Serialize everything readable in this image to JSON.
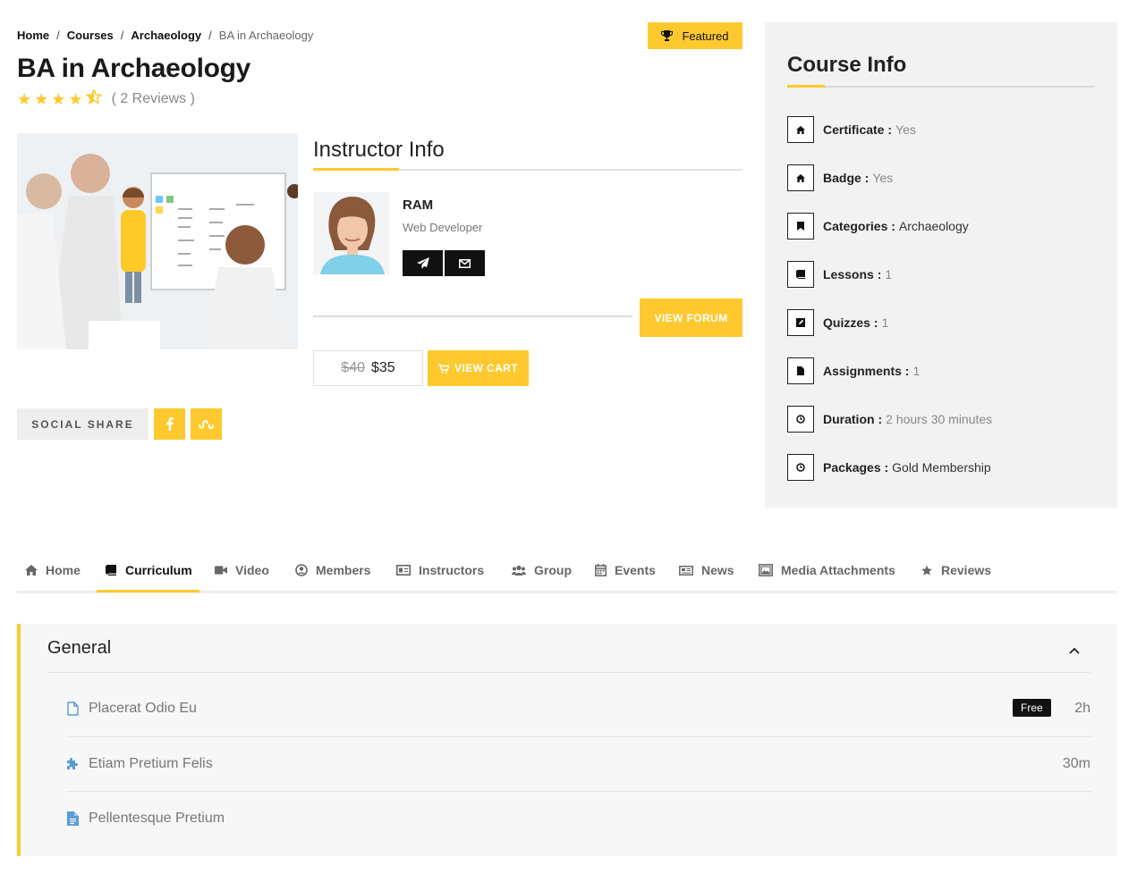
{
  "breadcrumb": {
    "items": [
      "Home",
      "Courses",
      "Archaeology"
    ],
    "current": "BA in Archaeology",
    "separator": "/"
  },
  "featured": {
    "label": "Featured",
    "icon": "trophy-icon"
  },
  "course": {
    "title": "BA in Archaeology",
    "rating": 4.5,
    "reviews_label": "( 2 Reviews )"
  },
  "instructor": {
    "heading": "Instructor Info",
    "name": "RAM",
    "role": "Web Developer",
    "buttons": [
      "paper-plane-icon",
      "envelope-icon"
    ]
  },
  "actions": {
    "view_forum": "VIEW FORUM",
    "price_old": "$40",
    "price_new": "$35",
    "view_cart": "VIEW CART"
  },
  "social": {
    "label": "SOCIAL SHARE",
    "buttons": [
      "facebook-icon",
      "stumbleupon-icon"
    ]
  },
  "course_info": {
    "heading": "Course Info",
    "items": [
      {
        "label": "Certificate :",
        "value": "Yes",
        "icon": "home-icon"
      },
      {
        "label": "Badge :",
        "value": "Yes",
        "icon": "home-icon"
      },
      {
        "label": "Categories :",
        "value": "Archaeology",
        "icon": "bookmark-icon"
      },
      {
        "label": "Lessons :",
        "value": "1",
        "icon": "book-icon"
      },
      {
        "label": "Quizzes :",
        "value": "1",
        "icon": "edit-icon"
      },
      {
        "label": "Assignments :",
        "value": "1",
        "icon": "file-icon"
      },
      {
        "label": "Duration :",
        "value": "2 hours 30 minutes",
        "icon": "clock-icon"
      },
      {
        "label": "Packages :",
        "value": "Gold Membership",
        "icon": "clock-icon"
      }
    ]
  },
  "tabs": [
    {
      "label": "Home",
      "icon": "home-icon"
    },
    {
      "label": "Curriculum",
      "icon": "book-icon",
      "active": true
    },
    {
      "label": "Video",
      "icon": "video-icon"
    },
    {
      "label": "Members",
      "icon": "user-circle-icon"
    },
    {
      "label": "Instructors",
      "icon": "id-card-icon"
    },
    {
      "label": "Group",
      "icon": "users-icon"
    },
    {
      "label": "Events",
      "icon": "calendar-icon"
    },
    {
      "label": "News",
      "icon": "newspaper-icon"
    },
    {
      "label": "Media Attachments",
      "icon": "image-icon"
    },
    {
      "label": "Reviews",
      "icon": "star-icon"
    }
  ],
  "curriculum": {
    "section_title": "General",
    "lessons": [
      {
        "title": "Placerat Odio Eu",
        "icon": "file-outline-icon",
        "badge": "Free",
        "duration": "2h"
      },
      {
        "title": "Etiam Pretium Felis",
        "icon": "puzzle-icon",
        "duration": "30m"
      },
      {
        "title": "Pellentesque Pretium",
        "icon": "file-text-icon",
        "duration": ""
      }
    ]
  },
  "colors": {
    "accent": "#fdc92f",
    "dark": "#111111",
    "panel": "#f2f2f2",
    "icon_blue": "#5b9bd5"
  }
}
